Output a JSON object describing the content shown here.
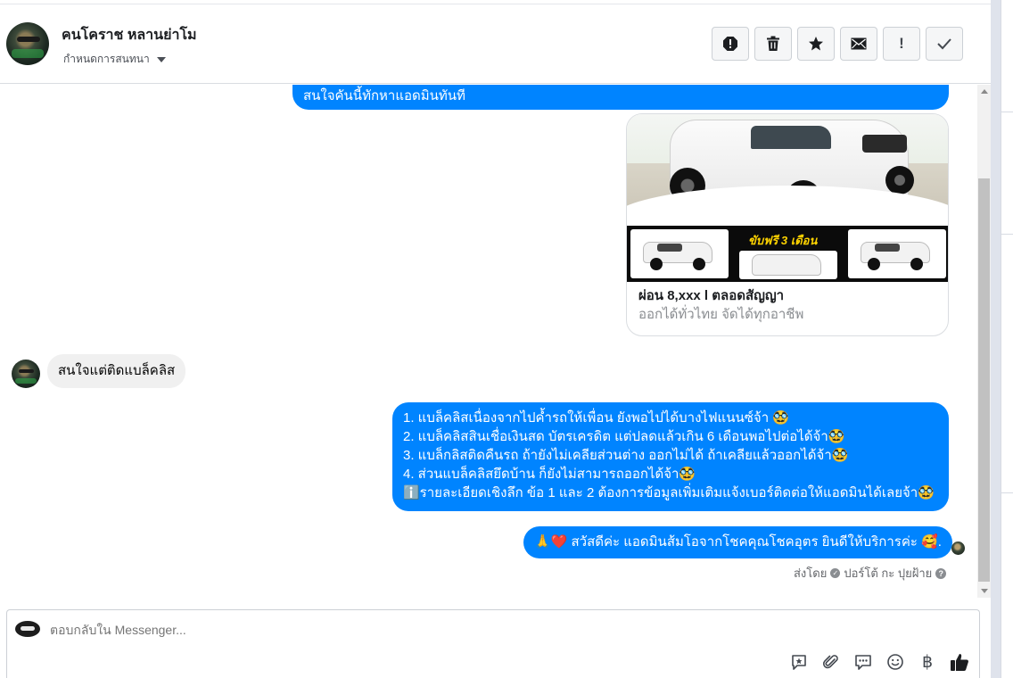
{
  "header": {
    "user_name": "คนโคราช หลานย่าโม",
    "label_dropdown": "กำหนดการสนทนา",
    "toolbar": [
      {
        "name": "report-spam-icon"
      },
      {
        "name": "trash-icon"
      },
      {
        "name": "star-icon"
      },
      {
        "name": "mail-icon"
      },
      {
        "name": "important-icon",
        "text": "!"
      },
      {
        "name": "check-icon"
      }
    ]
  },
  "messages": {
    "top_banner": "สนใจคันนี้ทักหาแอดมินทันที",
    "card": {
      "promo": "ขับฟรี 3 เดือน",
      "title": "ผ่อน 8,xxx l ตลอดสัญญา",
      "subtitle": "ออกได้ทั่วไทย จัดได้ทุกอาชีพ"
    },
    "incoming": "สนใจแต่ติดแบล็คลิส",
    "reply_lines": [
      "1. แบล็คลิสเนื่องจากไปค้ำรถให้เพื่อน ยังพอไปได้บางไฟแนนซ์จ้า 🥸",
      "2. แบล็คลิสสินเชื่อเงินสด บัตรเครดิต แต่ปลดแล้วเกิน 6 เดือนพอไปต่อได้จ้า🥸",
      "3. แบล็กลิสติดคืนรถ ถ้ายังไม่เคลียส่วนต่าง ออกไม่ได้ ถ้าเคลียแล้วออกได้จ้า🥸",
      "4. ส่วนแบล็คลิสยึดบ้าน ก็ยังไม่สามารถออกได้จ้า🥸",
      "ℹ️รายละเอียดเชิงลึก ข้อ 1 และ 2 ต้องการข้อมูลเพิ่มเติมแจ้งเบอร์ติดต่อให้แอดมินได้เลยจ้า🥸"
    ],
    "greeting": "🙏❤️ สวัสดีค่ะ แอดมินส้มโอจากโชคคุณโชคอุตร ยินดีให้บริการค่ะ  🥰.",
    "sent_by_prefix": "ส่งโดย",
    "sent_by_name": "ปอร์โต้ กะ ปุยฝ้าย"
  },
  "composer": {
    "placeholder": "ตอบกลับใน Messenger...",
    "tools": [
      {
        "name": "saved-reply-icon"
      },
      {
        "name": "attachment-icon"
      },
      {
        "name": "quick-reply-icon"
      },
      {
        "name": "emoji-icon"
      },
      {
        "name": "baht-payment-icon",
        "text": "฿"
      },
      {
        "name": "like-icon"
      }
    ]
  }
}
